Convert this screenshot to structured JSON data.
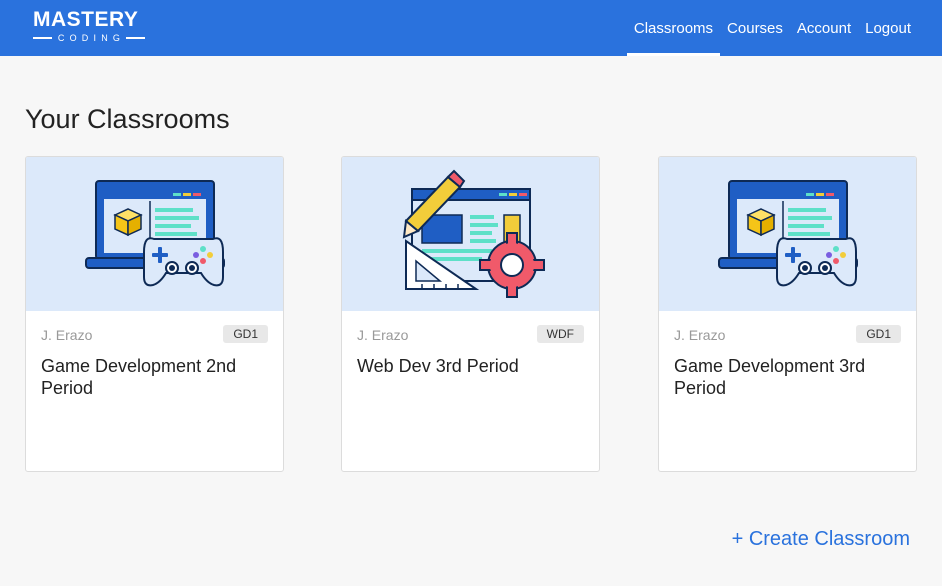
{
  "header": {
    "logo_main": "MASTERY",
    "logo_sub": "CODING",
    "nav": [
      {
        "label": "Classrooms",
        "active": true
      },
      {
        "label": "Courses",
        "active": false
      },
      {
        "label": "Account",
        "active": false
      },
      {
        "label": "Logout",
        "active": false
      }
    ]
  },
  "main": {
    "title": "Your Classrooms",
    "classrooms": [
      {
        "teacher": "J. Erazo",
        "code": "GD1",
        "name": "Game Development 2nd Period",
        "illustration": "laptop-gamepad-icon"
      },
      {
        "teacher": "J. Erazo",
        "code": "WDF",
        "name": "Web Dev 3rd Period",
        "illustration": "web-design-gear-icon"
      },
      {
        "teacher": "J. Erazo",
        "code": "GD1",
        "name": "Game Development 3rd Period",
        "illustration": "laptop-gamepad-icon"
      }
    ],
    "create_label": "+ Create Classroom"
  },
  "colors": {
    "brand_blue": "#2a72dd",
    "hero_bg": "#dce9fa"
  }
}
